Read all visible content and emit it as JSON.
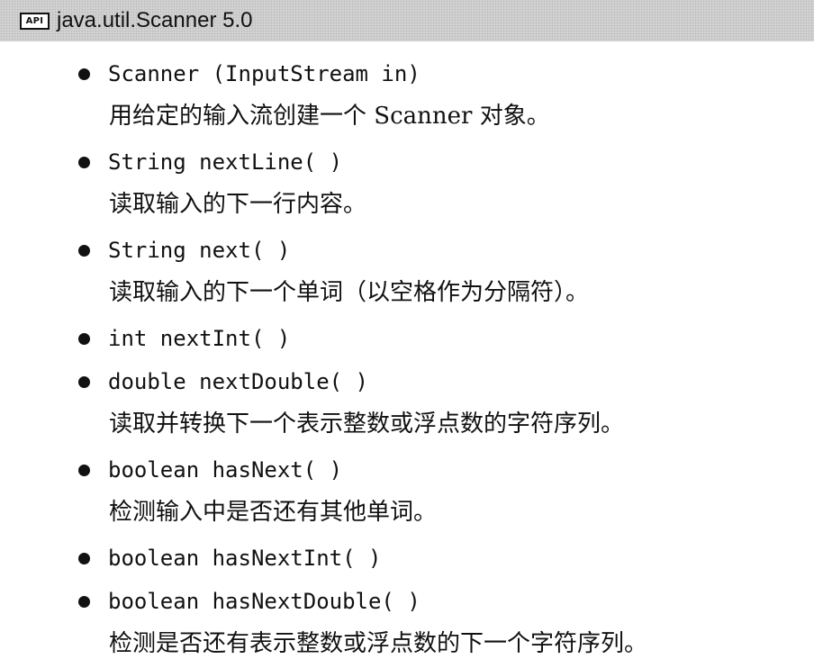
{
  "header": {
    "badge": "API",
    "title": "java.util.Scanner 5.0"
  },
  "entries": [
    {
      "signature": "Scanner (InputStream in)",
      "description": "用给定的输入流创建一个 Scanner 对象。"
    },
    {
      "signature": "String nextLine( )",
      "description": "读取输入的下一行内容。"
    },
    {
      "signature": "String next( )",
      "description": "读取输入的下一个单词（以空格作为分隔符）。"
    },
    {
      "signature": "int nextInt( )",
      "description": ""
    },
    {
      "signature": "double nextDouble( )",
      "description": "读取并转换下一个表示整数或浮点数的字符序列。"
    },
    {
      "signature": "boolean hasNext( )",
      "description": "检测输入中是否还有其他单词。"
    },
    {
      "signature": "boolean hasNextInt( )",
      "description": ""
    },
    {
      "signature": "boolean hasNextDouble( )",
      "description": "检测是否还有表示整数或浮点数的下一个字符序列。"
    }
  ]
}
